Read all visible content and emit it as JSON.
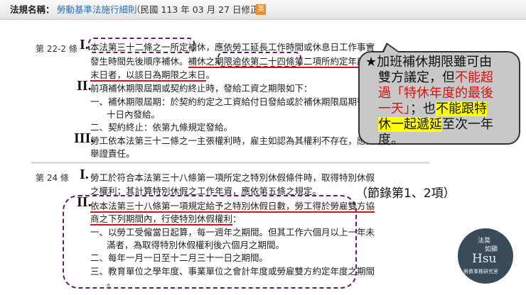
{
  "header": {
    "label": "法規名稱：",
    "law_name": "勞動基準法施行細則",
    "amend_date": "（民國 113 年 03 月 27 日修正）",
    "en_badge": "英"
  },
  "art22_2": {
    "number": "第 22-2 條",
    "p1": {
      "numeral": "I.",
      "parts": [
        "本法第三十二條之一所定補休",
        "，應依勞工延長工作時間或休息日工作事實",
        "發生時間先後順序補休。",
        "補休之期限",
        "逾依第二十四條第二項",
        "所約定年度之",
        "末日者，以該日為期限之末日",
        "。"
      ]
    },
    "p2": {
      "numeral": "II.",
      "text": "前項補休期限屆期或契約終止時，發給工資之期限如下：",
      "items": [
        "一、補休期限屆期：於契約約定之工資給付日發給或於補休期限屆期後三",
        "十日內發給。",
        "二、契約終止：依第九條規定發給。"
      ]
    },
    "p3": {
      "numeral": "III.",
      "text": "勞工依本法第三十二條之一主張權利時，雇主如認為其權利不存在，應負",
      "text2": "舉證責任。"
    }
  },
  "art24": {
    "number": "第 24 條",
    "p1": {
      "numeral": "I.",
      "line1": "勞工於符合本法第三十八條第一項所定之特別休假條件時，取得特別休假",
      "line2": "之權利；其計算特別休假之工作年資，應依第五條之規定。"
    },
    "p2": {
      "numeral": "II.",
      "line1": "依本法第三十八條第一項規定給予之特別休假日數，勞工得於勞雇雙方協",
      "line2": "商之下列期間內，行使特別休假權利",
      "line2_end": "：",
      "items": [
        "一、以勞工受僱當日起算，每一週年之期間。但其工作六個月以上一年未",
        "滿者，為取得特別休假權利後六個月之期間。",
        "二、每年一月一日至十二月三十一日之期間。",
        "三、教育單位之學年度、事業單位之會計年度或勞雇雙方約定年度之期間",
        "。"
      ]
    }
  },
  "callout": {
    "l1": "★加班補休期限雖可由",
    "l2a": "雙方議定，但",
    "l2b": "不能超",
    "l3": "過「特休年度的最後",
    "l4a": "一天」",
    "l4b": "；也",
    "l4c": "不能跟特",
    "l5a": "休一起遞延",
    "l5b": "至次一年",
    "l6": "度。"
  },
  "note": "（節錄第1、2項）",
  "logo": {
    "top1": "法莫",
    "top2": "如顯",
    "main": "Hsu",
    "bottom": "勞資事務研究室"
  },
  "colors": {
    "accent_red": "#e01010",
    "dash_purple": "#6b1a6b",
    "highlight": "#ffff00",
    "logo_bg": "#3a4b57"
  }
}
